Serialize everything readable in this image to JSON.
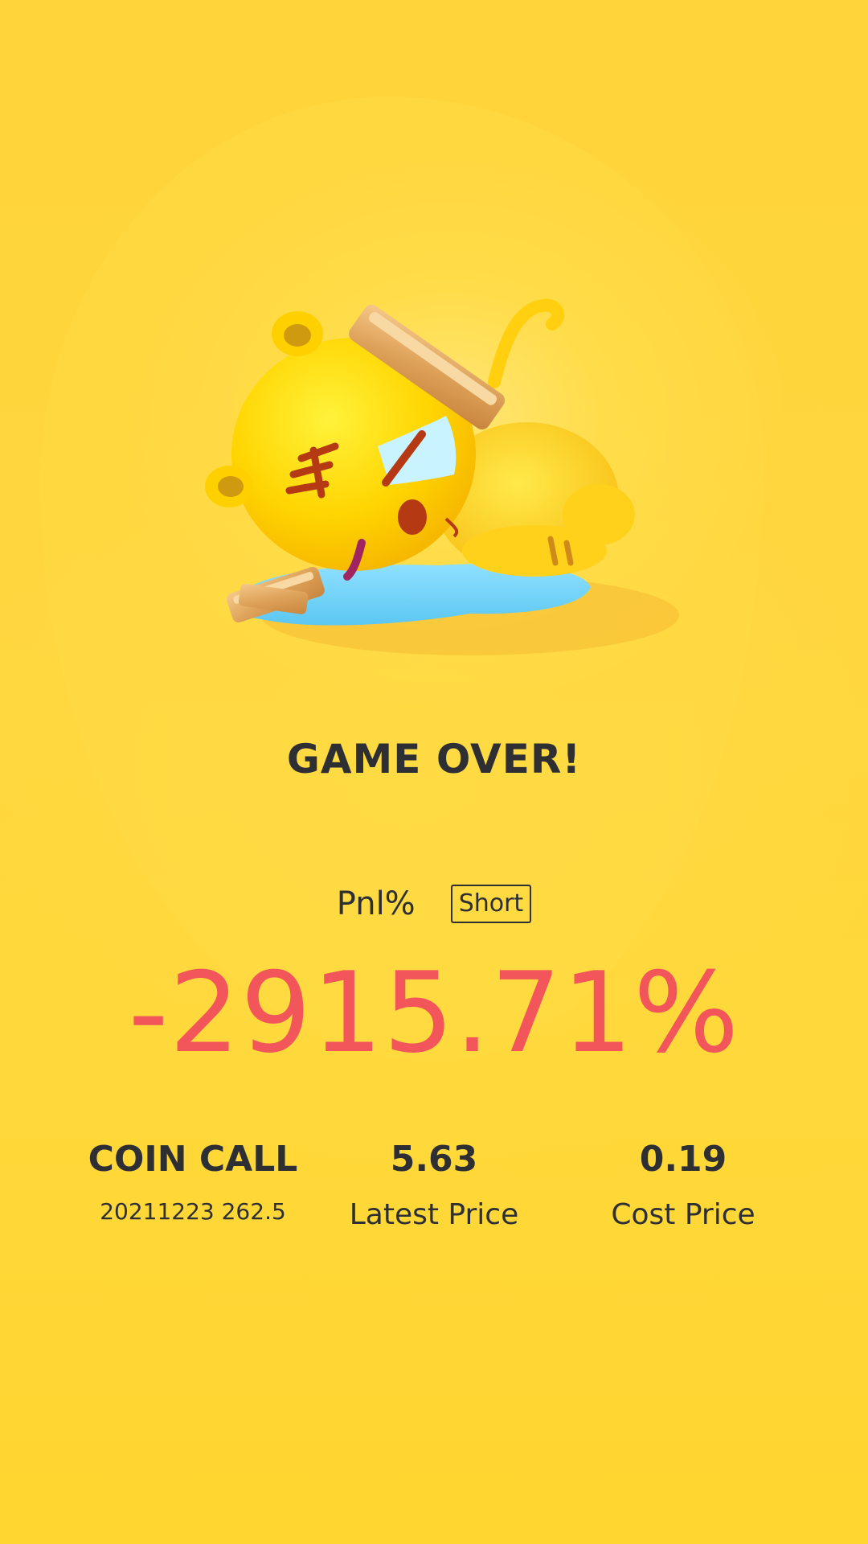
{
  "result": {
    "title": "GAME OVER!",
    "pnl_label": "Pnl%",
    "position_badge": "Short",
    "pnl_value": "-2915.71%"
  },
  "stats": [
    {
      "value": "COIN CALL",
      "label": "20211223 262.5"
    },
    {
      "value": "5.63",
      "label": "Latest Price"
    },
    {
      "value": "0.19",
      "label": "Cost Price"
    }
  ],
  "colors": {
    "background": "#ffd737",
    "text": "#2d2f33",
    "loss": "#f2565a"
  },
  "illustration": {
    "icon": "knocked-out-tiger-mascot-with-gold-bar"
  }
}
